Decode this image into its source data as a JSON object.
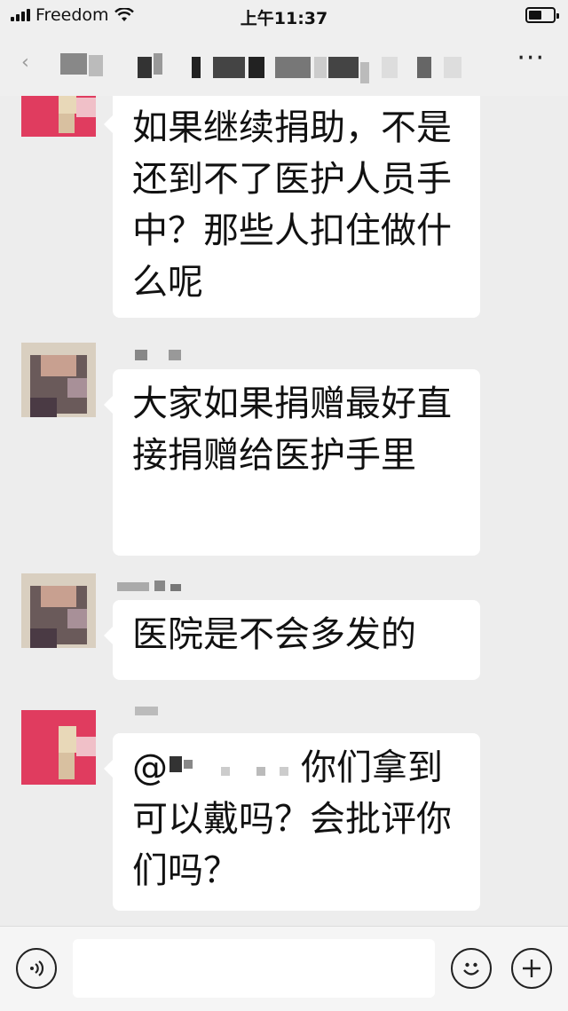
{
  "status_bar": {
    "carrier": "Freedom",
    "time": "上午11:37"
  },
  "nav": {
    "more_label": "···"
  },
  "messages": [
    {
      "text": "如果继续捐助，不是还到不了医护人员手中？那些人扣住做什么呢"
    },
    {
      "text": "大家如果捐赠最好直接捐赠给医护手里"
    },
    {
      "text": "医院是不会多发的"
    },
    {
      "mention": "@",
      "text": "你们拿到可以戴吗？会批评你们吗？"
    }
  ],
  "input_bar": {
    "voice_icon": "voice-icon",
    "emoji_icon": "emoji-icon",
    "plus_icon": "plus-icon"
  }
}
